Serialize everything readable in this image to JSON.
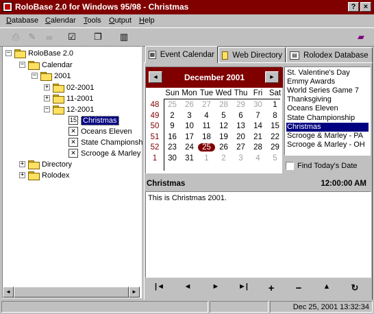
{
  "window": {
    "title": "RoloBase 2.0 for Windows 95/98 - Christmas",
    "help_btn": "?",
    "close_btn": "×"
  },
  "menu": {
    "database": "Database",
    "calendar": "Calendar",
    "tools": "Tools",
    "output": "Output",
    "help": "Help"
  },
  "toolbar": {
    "print_icon": "printer-icon",
    "edit_icon": "edit-icon",
    "find_icon": "binoculars-icon",
    "checklist_icon": "checklist-icon",
    "schedule_icon": "schedule-icon",
    "exit_icon": "exit-door-icon",
    "book_icon": "book-icon"
  },
  "tree": {
    "root": "RoloBase 2.0",
    "calendar": "Calendar",
    "year": "2001",
    "feb": "02-2001",
    "nov": "11-2001",
    "dec": "12-2001",
    "ev_christmas": "Christmas",
    "ev_oceans": "Oceans Eleven",
    "ev_state": "State Championsh",
    "ev_scrooge": "Scrooge & Marley",
    "directory": "Directory",
    "rolodex": "Rolodex",
    "exp_minus": "−",
    "exp_plus": "+"
  },
  "tabs": {
    "event_calendar": "Event Calendar",
    "web_directory": "Web Directory",
    "rolodex_database": "Rolodex Database"
  },
  "calendar": {
    "month_title": "December 2001",
    "prev": "◄",
    "next": "►",
    "dow": [
      "Sun",
      "Mon",
      "Tue",
      "Wed",
      "Thu",
      "Fri",
      "Sat"
    ],
    "weeks": [
      "48",
      "49",
      "50",
      "51",
      "52",
      "1"
    ],
    "days": [
      [
        "25",
        "26",
        "27",
        "28",
        "29",
        "30",
        "1"
      ],
      [
        "2",
        "3",
        "4",
        "5",
        "6",
        "7",
        "8"
      ],
      [
        "9",
        "10",
        "11",
        "12",
        "13",
        "14",
        "15"
      ],
      [
        "16",
        "17",
        "18",
        "19",
        "20",
        "21",
        "22"
      ],
      [
        "23",
        "24",
        "25",
        "26",
        "27",
        "28",
        "29"
      ],
      [
        "30",
        "31",
        "1",
        "2",
        "3",
        "4",
        "5"
      ]
    ],
    "selected_day": "25"
  },
  "events": {
    "items": [
      "St. Valentine's Day",
      "Emmy Awards",
      "World Series Game 7",
      "Thanksgiving",
      "Oceans Eleven",
      "State Championship",
      "Christmas",
      "Scrooge & Marley - PA",
      "Scrooge & Marley - OH"
    ],
    "selected": "Christmas"
  },
  "find_today": "Find Today's Date",
  "detail": {
    "title": "Christmas",
    "time": "12:00:00 AM",
    "notes": "This is Christmas 2001."
  },
  "nav": {
    "first": "|◄",
    "prev": "◄",
    "next": "►",
    "last": "►|",
    "add": "+",
    "delete": "−",
    "edit": "▲",
    "refresh": "↻"
  },
  "status": {
    "pane1": "",
    "pane2": "",
    "datetime": "Dec 25, 2001 13:32:34"
  },
  "colors": {
    "accent": "#800000",
    "selection": "#000080",
    "face": "#c0c0c0"
  }
}
